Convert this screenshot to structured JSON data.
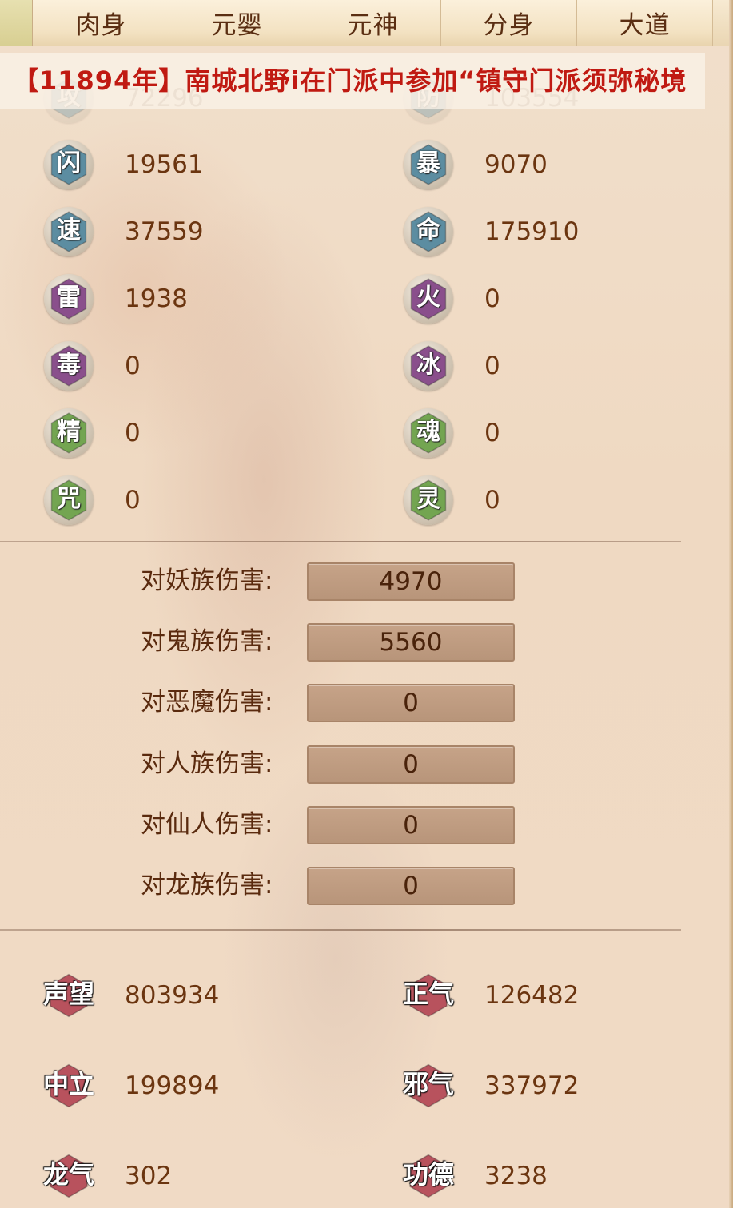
{
  "tabs": [
    "肉身",
    "元婴",
    "元神",
    "分身",
    "大道"
  ],
  "marquee": "【11894年】南城北野i在门派中参加“镇守门派须弥秘境",
  "colors": {
    "marquee_text": "#c01a12",
    "hex_blue": "#5c8da1",
    "hex_purple": "#8a4f8c",
    "hex_green": "#73a551",
    "hex_red": "#b8525d"
  },
  "stats_top": [
    {
      "icon": "攻",
      "value": "72296",
      "color": "blue"
    },
    {
      "icon": "防",
      "value": "103554",
      "color": "blue"
    }
  ],
  "stats": [
    {
      "icon": "闪",
      "value": "19561",
      "color": "blue"
    },
    {
      "icon": "暴",
      "value": "9070",
      "color": "blue"
    },
    {
      "icon": "速",
      "value": "37559",
      "color": "blue"
    },
    {
      "icon": "命",
      "value": "175910",
      "color": "blue"
    },
    {
      "icon": "雷",
      "value": "1938",
      "color": "purple"
    },
    {
      "icon": "火",
      "value": "0",
      "color": "purple"
    },
    {
      "icon": "毒",
      "value": "0",
      "color": "purple"
    },
    {
      "icon": "冰",
      "value": "0",
      "color": "purple"
    },
    {
      "icon": "精",
      "value": "0",
      "color": "green"
    },
    {
      "icon": "魂",
      "value": "0",
      "color": "green"
    },
    {
      "icon": "咒",
      "value": "0",
      "color": "green"
    },
    {
      "icon": "灵",
      "value": "0",
      "color": "green"
    }
  ],
  "damage": [
    {
      "label": "对妖族伤害:",
      "value": "4970"
    },
    {
      "label": "对鬼族伤害:",
      "value": "5560"
    },
    {
      "label": "对恶魔伤害:",
      "value": "0"
    },
    {
      "label": "对人族伤害:",
      "value": "0"
    },
    {
      "label": "对仙人伤害:",
      "value": "0"
    },
    {
      "label": "对龙族伤害:",
      "value": "0"
    }
  ],
  "reputation": [
    {
      "label": "声望",
      "value": "803934"
    },
    {
      "label": "正气",
      "value": "126482"
    },
    {
      "label": "中立",
      "value": "199894"
    },
    {
      "label": "邪气",
      "value": "337972"
    },
    {
      "label": "龙气",
      "value": "302"
    },
    {
      "label": "功德",
      "value": "3238"
    }
  ]
}
